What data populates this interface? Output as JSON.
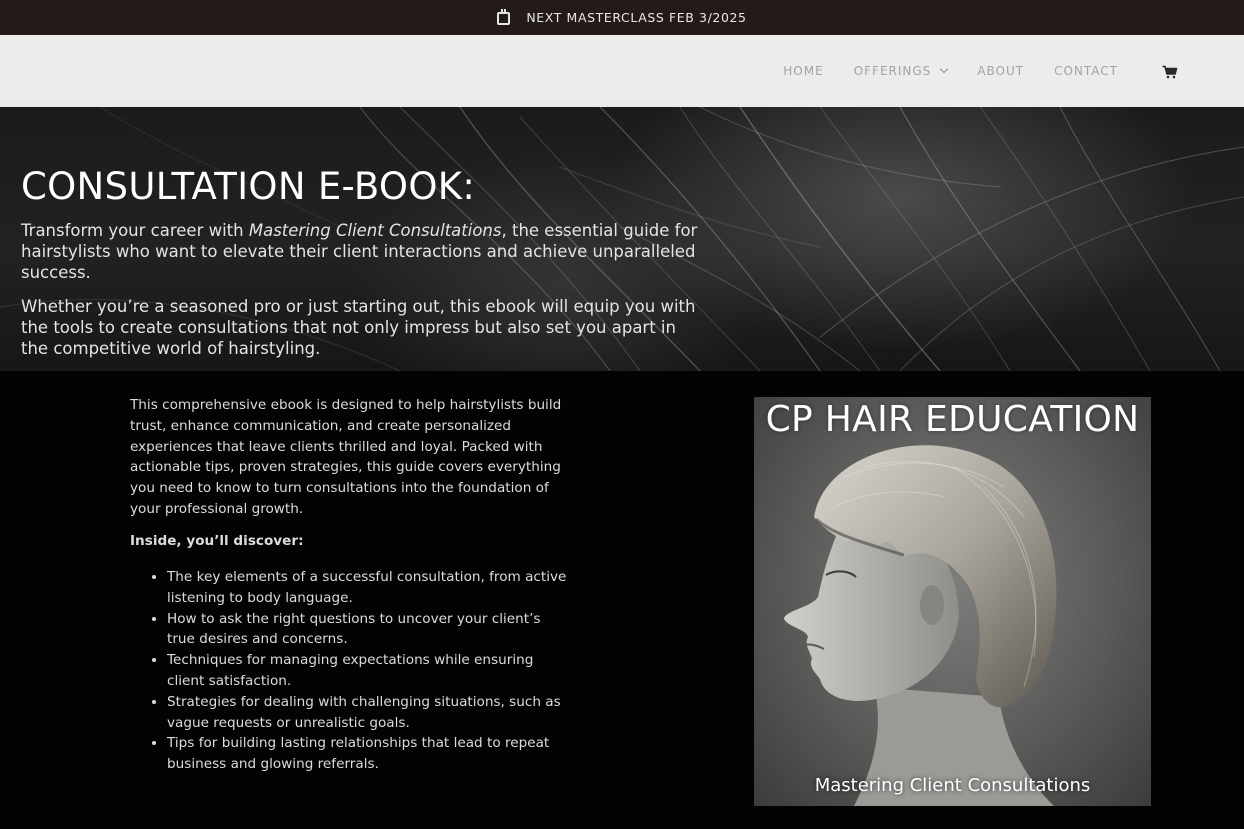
{
  "announcement": {
    "icon": "calendar-icon",
    "text": "NEXT MASTERCLASS FEB 3/2025"
  },
  "nav": {
    "items": [
      {
        "label": "HOME"
      },
      {
        "label": "OFFERINGS"
      },
      {
        "label": "ABOUT"
      },
      {
        "label": "CONTACT"
      }
    ],
    "cart_icon": "cart-icon",
    "dropdown_icon": "chevron-down-icon"
  },
  "hero": {
    "title": "CONSULTATION E-BOOK:",
    "p1_before": "Transform your career with ",
    "p1_italic": "Mastering Client Consultations",
    "p1_after": ", the essential guide for hairstylists who want to elevate their client interactions and achieve unparalleled success.",
    "p2": "Whether you’re a seasoned pro or just starting out, this ebook will equip you with the tools to create consultations that not only impress but also set you apart in the competitive world of hairstyling."
  },
  "content": {
    "description": "This comprehensive ebook is designed to help hairstylists build trust, enhance communication, and create personalized experiences that leave clients thrilled and loyal. Packed with actionable tips, proven strategies, this guide covers everything you need to know to turn consultations into the foundation of your professional growth.",
    "inside_heading": "Inside, you’ll discover:",
    "features": [
      "The key elements of a successful consultation, from active listening to body language.",
      "How to ask the right questions to uncover your client’s true desires and concerns.",
      "Techniques for managing expectations while ensuring client satisfaction.",
      "Strategies for dealing with challenging situations, such as vague requests or unrealistic goals.",
      "Tips for building lasting relationships that lead to repeat business and glowing referrals."
    ]
  },
  "cover": {
    "brand": "CP HAIR EDUCATION",
    "title": "Mastering Client Consultations"
  },
  "colors": {
    "announcement_bg": "#231b18",
    "header_bg": "#ececea",
    "nav_text": "#a3a3a1",
    "page_bg": "#000000"
  }
}
